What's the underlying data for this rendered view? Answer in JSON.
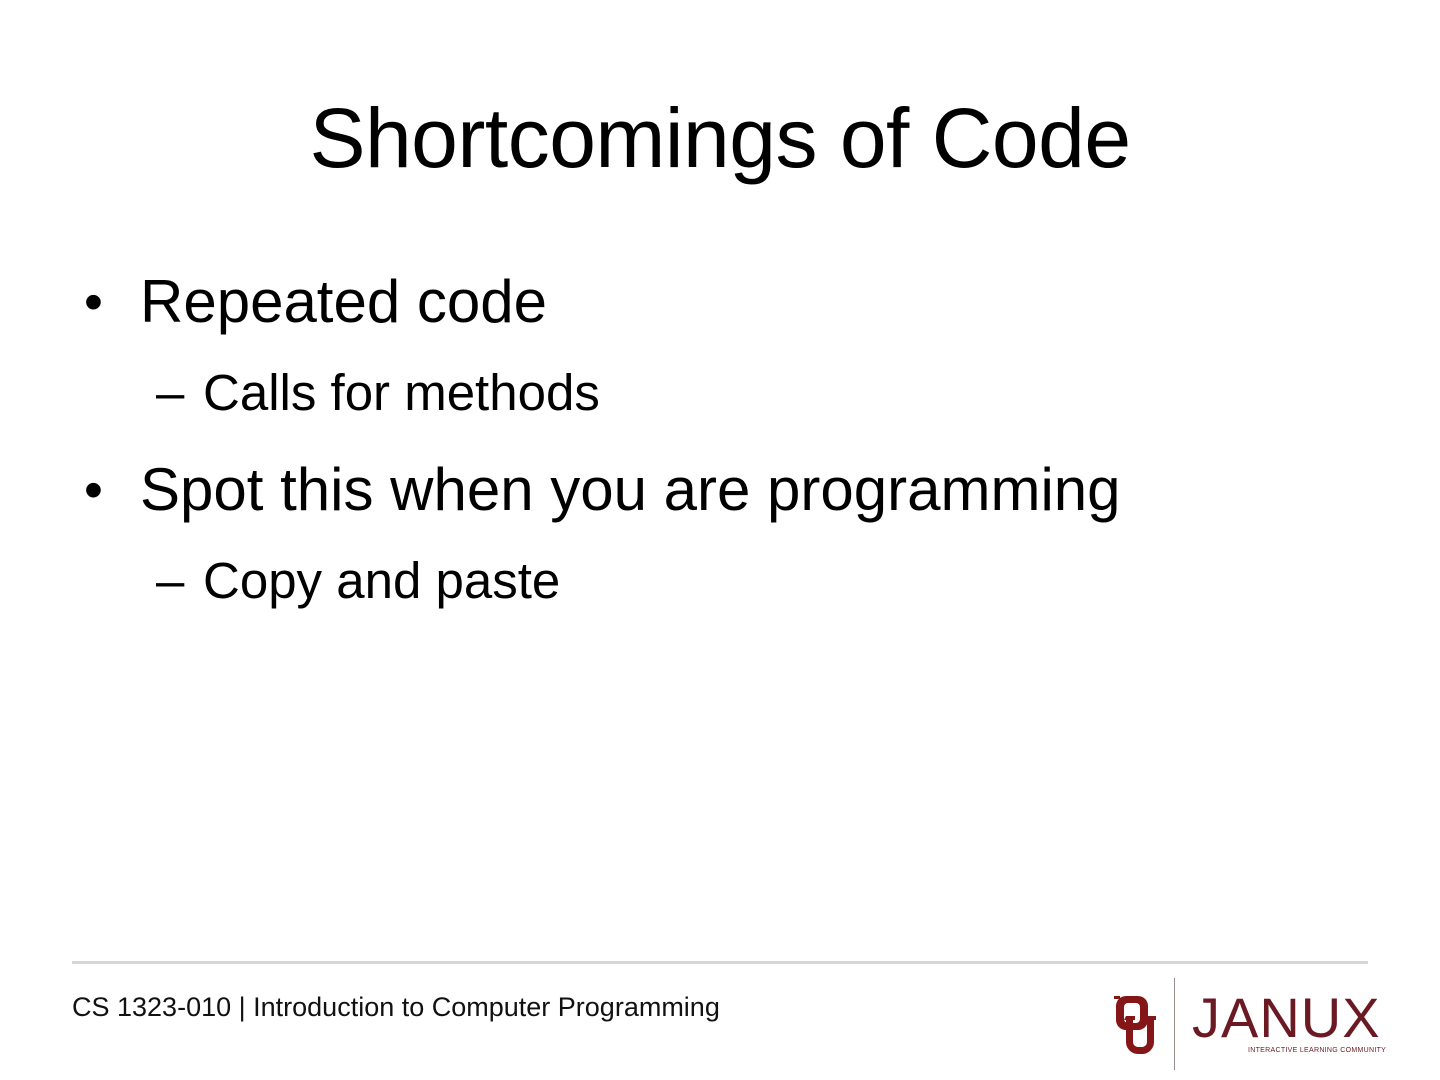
{
  "slide": {
    "title": "Shortcomings of Code",
    "bullets": [
      {
        "marker": "•",
        "text": "Repeated code",
        "sub": {
          "marker": "–",
          "text": "Calls for methods"
        }
      },
      {
        "marker": "•",
        "text": "Spot this when you are programming",
        "sub": {
          "marker": "–",
          "text": "Copy and paste"
        }
      }
    ]
  },
  "footer": {
    "course": "CS 1323-010 | Introduction to Computer Programming",
    "logo": {
      "icon": "ou-interlocking-logo-icon",
      "wordmark": "JANUX",
      "tagline": "INTERACTIVE LEARNING COMMUNITY",
      "brand_color": "#841617",
      "wordmark_color": "#6b1a24"
    }
  }
}
